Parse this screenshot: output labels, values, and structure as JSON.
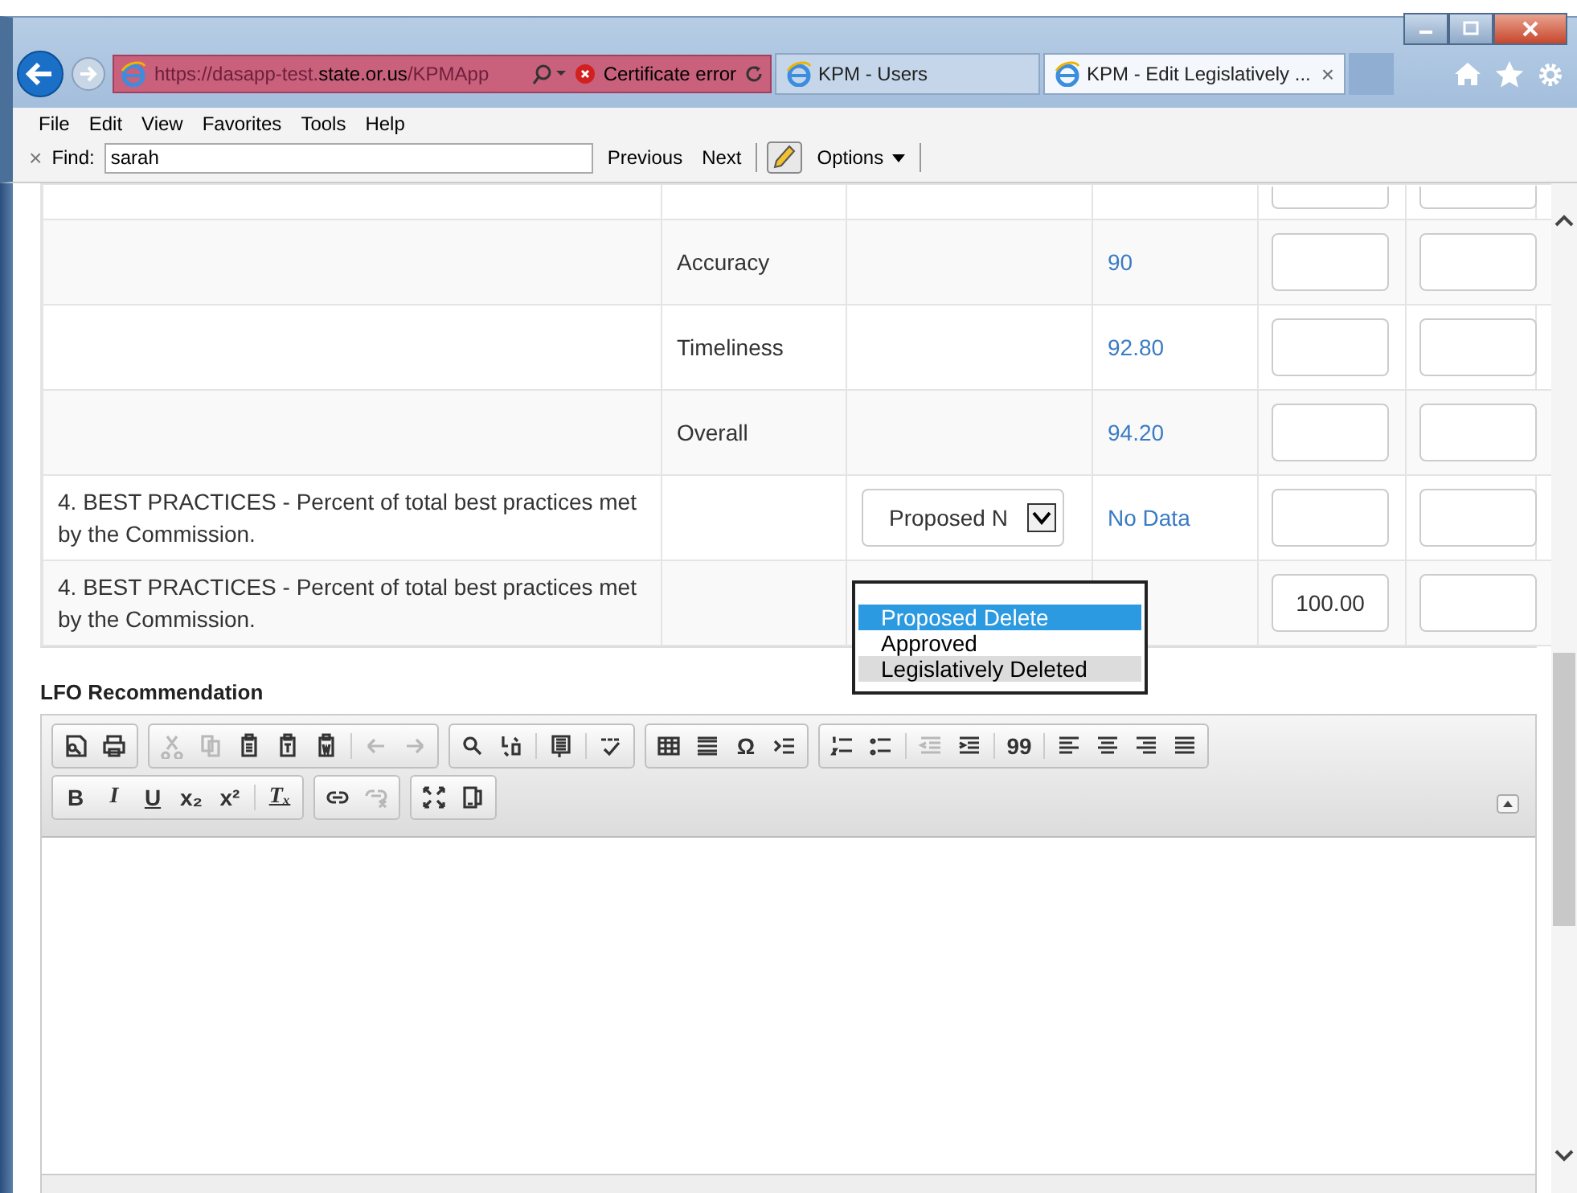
{
  "browser": {
    "address_dim_prefix": "https://dasapp-test.",
    "address_host": "state.or.us",
    "address_dim_suffix": "/KPMApp",
    "certificate": "Certificate error",
    "tabs": [
      {
        "label": "KPM - Users",
        "selected": false
      },
      {
        "label": "KPM - Edit Legislatively ...",
        "selected": true
      }
    ],
    "close_glyph": "×"
  },
  "menu": [
    "File",
    "Edit",
    "View",
    "Favorites",
    "Tools",
    "Help"
  ],
  "find": {
    "close_glyph": "×",
    "label": "Find:",
    "value": "sarah",
    "previous": "Previous",
    "next": "Next",
    "options": "Options"
  },
  "table": {
    "rows": [
      {
        "measure": "",
        "category": "",
        "status": null,
        "value": "",
        "input_1": "",
        "input_2": ""
      },
      {
        "measure": "",
        "category": "Accuracy",
        "status": null,
        "value": "90",
        "input_1": "",
        "input_2": ""
      },
      {
        "measure": "",
        "category": "Timeliness",
        "status": null,
        "value": "92.80",
        "input_1": "",
        "input_2": ""
      },
      {
        "measure": "",
        "category": "Overall",
        "status": null,
        "value": "94.20",
        "input_1": "",
        "input_2": ""
      },
      {
        "measure": "4. BEST PRACTICES - Percent of total best practices met by the Commission.",
        "category": "",
        "status": "Proposed N",
        "value": "No Data",
        "input_1": "",
        "input_2": ""
      },
      {
        "measure": "4. BEST PRACTICES - Percent of total best practices met by the Commission.",
        "category": "",
        "status": null,
        "value": "",
        "input_1": "100.00",
        "input_2": ""
      }
    ]
  },
  "dropdown": {
    "options": [
      {
        "label": "Proposed Delete",
        "selected": true,
        "hover": false
      },
      {
        "label": "Approved",
        "selected": false,
        "hover": false
      },
      {
        "label": "Legislatively Deleted",
        "selected": false,
        "hover": true
      }
    ]
  },
  "editor": {
    "label": "LFO Recommendation",
    "toolbar_rows": [
      [
        [
          {
            "kind": "preview",
            "disabled": false
          },
          {
            "kind": "print",
            "disabled": false
          }
        ],
        [
          {
            "kind": "cut",
            "disabled": true
          },
          {
            "kind": "copy",
            "disabled": true
          },
          {
            "kind": "paste",
            "disabled": false
          },
          {
            "kind": "paste-text",
            "disabled": false
          },
          {
            "kind": "paste-word",
            "disabled": false
          },
          {
            "kind": "sep"
          },
          {
            "kind": "undo",
            "disabled": true
          },
          {
            "kind": "redo",
            "disabled": true
          }
        ],
        [
          {
            "kind": "search",
            "disabled": false
          },
          {
            "kind": "replace",
            "disabled": false
          },
          {
            "kind": "sep"
          },
          {
            "kind": "select-all",
            "disabled": false
          },
          {
            "kind": "sep"
          },
          {
            "kind": "spellcheck",
            "disabled": false
          }
        ],
        [
          {
            "kind": "table",
            "disabled": false
          },
          {
            "kind": "hline",
            "disabled": false
          },
          {
            "kind": "symbol",
            "label": "Ω",
            "disabled": false
          },
          {
            "kind": "pagebreak",
            "disabled": false
          }
        ],
        [
          {
            "kind": "numlist",
            "disabled": false
          },
          {
            "kind": "bullist",
            "disabled": false
          },
          {
            "kind": "sep"
          },
          {
            "kind": "outdent",
            "disabled": true
          },
          {
            "kind": "indent",
            "disabled": false
          },
          {
            "kind": "sep"
          },
          {
            "kind": "quote",
            "label": "99",
            "disabled": false
          },
          {
            "kind": "sep"
          },
          {
            "kind": "align-left",
            "disabled": false
          },
          {
            "kind": "align-center",
            "disabled": false
          },
          {
            "kind": "align-right",
            "disabled": false
          },
          {
            "kind": "justify",
            "disabled": false
          }
        ]
      ],
      [
        [
          {
            "kind": "bold",
            "label": "B",
            "disabled": false
          },
          {
            "kind": "italic",
            "label": "I",
            "disabled": false
          },
          {
            "kind": "underline",
            "label": "U",
            "disabled": false
          },
          {
            "kind": "subscript",
            "label": "x₂",
            "disabled": false
          },
          {
            "kind": "superscript",
            "label": "x²",
            "disabled": false
          },
          {
            "kind": "sep"
          },
          {
            "kind": "clear-format",
            "label": "Tₓ",
            "disabled": false
          }
        ],
        [
          {
            "kind": "link",
            "disabled": false
          },
          {
            "kind": "unlink",
            "disabled": true
          }
        ],
        [
          {
            "kind": "maximize",
            "disabled": false
          },
          {
            "kind": "blocks",
            "disabled": false
          }
        ]
      ]
    ]
  }
}
